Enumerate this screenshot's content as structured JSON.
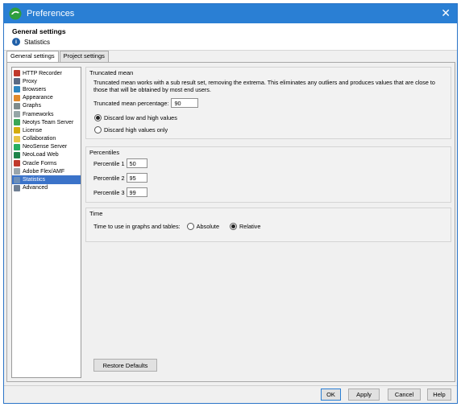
{
  "window": {
    "title": "Preferences",
    "close_glyph": "✕"
  },
  "header": {
    "title": "General settings",
    "subtitle": "Statistics",
    "info_glyph": "i"
  },
  "tabs": [
    {
      "label": "General settings",
      "active": true
    },
    {
      "label": "Project settings",
      "active": false
    }
  ],
  "sidebar": {
    "items": [
      {
        "label": "HTTP Recorder",
        "icon": "recorder-icon",
        "color": "#c0392b"
      },
      {
        "label": "Proxy",
        "icon": "proxy-icon",
        "color": "#5b6b84"
      },
      {
        "label": "Browsers",
        "icon": "browser-icon",
        "color": "#2e86c1"
      },
      {
        "label": "Appearance",
        "icon": "appearance-icon",
        "color": "#e08a2c"
      },
      {
        "label": "Graphs",
        "icon": "graph-icon",
        "color": "#7f8c8d"
      },
      {
        "label": "Frameworks",
        "icon": "frameworks-icon",
        "color": "#95a5a6"
      },
      {
        "label": "Neotys Team Server",
        "icon": "team-server-icon",
        "color": "#3aa655"
      },
      {
        "label": "License",
        "icon": "key-icon",
        "color": "#d4ac0d"
      },
      {
        "label": "Collaboration",
        "icon": "collaboration-icon",
        "color": "#e8c547"
      },
      {
        "label": "NeoSense Server",
        "icon": "neosense-icon",
        "color": "#27ae60"
      },
      {
        "label": "NeoLoad Web",
        "icon": "neoload-web-icon",
        "color": "#1e8449"
      },
      {
        "label": "Oracle Forms",
        "icon": "oracle-icon",
        "color": "#c0392b"
      },
      {
        "label": "Adobe Flex/AMF",
        "icon": "flex-icon",
        "color": "#9aa5ab"
      },
      {
        "label": "Statistics",
        "icon": "statistics-icon",
        "color": "#6d8fb8",
        "selected": true
      },
      {
        "label": "Advanced",
        "icon": "advanced-icon",
        "color": "#6f7f93"
      }
    ]
  },
  "truncated": {
    "title": "Truncated mean",
    "description": "Truncated mean works with a sub result set, removing the extrema. This eliminates any outliers and produces values that are close to those that will be obtained by most end users.",
    "percentage_label": "Truncated mean percentage:",
    "percentage_value": "90",
    "option_low_high": "Discard low and high values",
    "option_high_only": "Discard high values only",
    "selected_option": "low_high"
  },
  "percentiles": {
    "title": "Percentiles",
    "p1_label": "Percentile 1",
    "p1_value": "50",
    "p2_label": "Percentile 2",
    "p2_value": "95",
    "p3_label": "Percentile 3",
    "p3_value": "99"
  },
  "time": {
    "title": "Time",
    "label": "Time to use in graphs and tables:",
    "option_absolute": "Absolute",
    "option_relative": "Relative",
    "selected_option": "relative"
  },
  "buttons": {
    "restore": "Restore Defaults",
    "ok": "OK",
    "apply": "Apply",
    "cancel": "Cancel",
    "help": "Help"
  },
  "colors": {
    "titlebar": "#2a7fd4",
    "selection": "#3b73c9"
  }
}
